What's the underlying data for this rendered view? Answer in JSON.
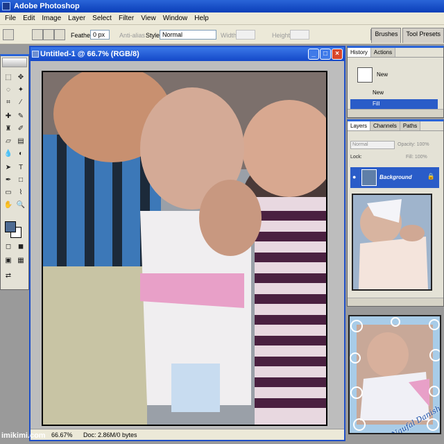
{
  "app": {
    "title": "Adobe Photoshop"
  },
  "menu": [
    "File",
    "Edit",
    "Image",
    "Layer",
    "Select",
    "Filter",
    "View",
    "Window",
    "Help"
  ],
  "options": {
    "feather_label": "Feather:",
    "feather_value": "0 px",
    "antialias_label": "Anti-alias",
    "style_label": "Style:",
    "style_value": "Normal",
    "width_label": "Width:",
    "height_label": "Height:"
  },
  "palette_well": [
    "Brushes",
    "Tool Presets"
  ],
  "document": {
    "title": "Untitled-1 @ 66.7% (RGB/8)",
    "zoom": "66.67%",
    "doc_info": "Doc: 2.86M/0 bytes"
  },
  "history": {
    "tabs": [
      "History",
      "Actions"
    ],
    "snapshot_label": "New",
    "items": [
      "New",
      "Fill"
    ]
  },
  "layers": {
    "tabs": [
      "Layers",
      "Channels",
      "Paths"
    ],
    "blend_mode": "Normal",
    "opacity_label": "Opacity:",
    "opacity_value": "100%",
    "fill_label": "Fill:",
    "fill_value": "100%",
    "lock_label": "Lock:",
    "layer_name": "Background"
  },
  "frame_caption": "Naufal Danish Arsy",
  "watermark": "imikimi.com",
  "colors": {
    "foreground": "#4e6b92",
    "background": "#ffffff",
    "selection": "#2a5cc8"
  }
}
